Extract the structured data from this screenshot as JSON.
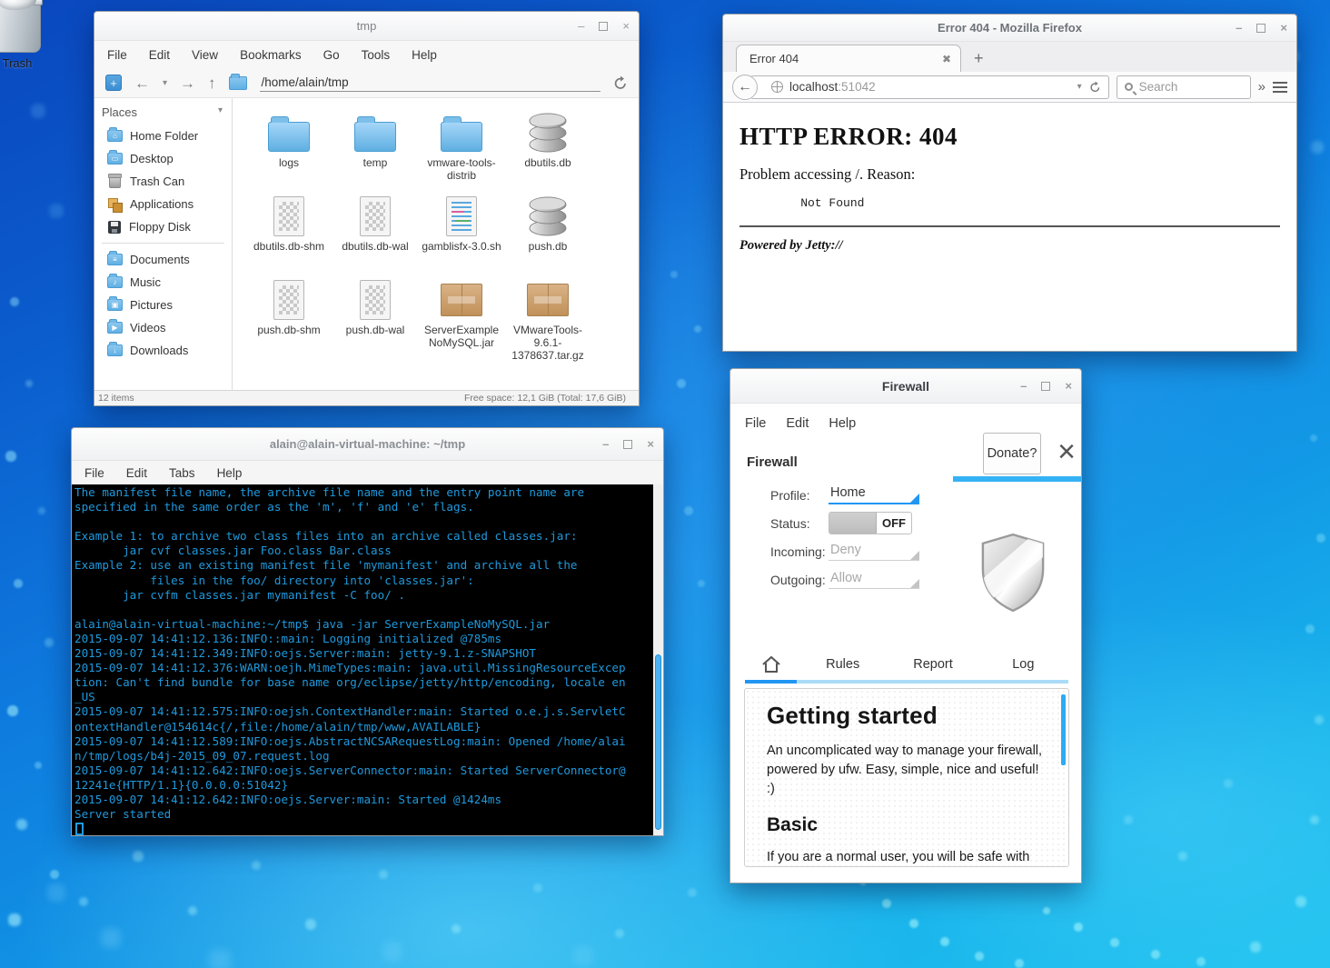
{
  "desktop": {
    "trash_label": "Trash"
  },
  "file_manager": {
    "title": "tmp",
    "menu": [
      "File",
      "Edit",
      "View",
      "Bookmarks",
      "Go",
      "Tools",
      "Help"
    ],
    "path": "/home/alain/tmp",
    "places_header": "Places",
    "places": [
      {
        "label": "Home Folder",
        "icon": "home-folder-icon"
      },
      {
        "label": "Desktop",
        "icon": "desktop-folder-icon"
      },
      {
        "label": "Trash Can",
        "icon": "trash-can-icon"
      },
      {
        "label": "Applications",
        "icon": "applications-icon"
      },
      {
        "label": "Floppy Disk",
        "icon": "floppy-disk-icon"
      },
      {
        "label": "Documents",
        "icon": "documents-folder-icon"
      },
      {
        "label": "Music",
        "icon": "music-folder-icon"
      },
      {
        "label": "Pictures",
        "icon": "pictures-folder-icon"
      },
      {
        "label": "Videos",
        "icon": "videos-folder-icon"
      },
      {
        "label": "Downloads",
        "icon": "downloads-folder-icon"
      }
    ],
    "files": [
      {
        "name": "logs",
        "type": "folder"
      },
      {
        "name": "temp",
        "type": "folder"
      },
      {
        "name": "vmware-tools-distrib",
        "type": "folder"
      },
      {
        "name": "dbutils.db",
        "type": "database"
      },
      {
        "name": "dbutils.db-shm",
        "type": "binary"
      },
      {
        "name": "dbutils.db-wal",
        "type": "binary"
      },
      {
        "name": "gamblisfx-3.0.sh",
        "type": "script"
      },
      {
        "name": "push.db",
        "type": "database"
      },
      {
        "name": "push.db-shm",
        "type": "binary"
      },
      {
        "name": "push.db-wal",
        "type": "binary"
      },
      {
        "name": "ServerExampleNoMySQL.jar",
        "type": "archive"
      },
      {
        "name": "VMwareTools-9.6.1-1378637.tar.gz",
        "type": "archive"
      }
    ],
    "status_left": "12 items",
    "status_right": "Free space: 12,1 GiB (Total: 17,6 GiB)"
  },
  "browser": {
    "window_title": "Error 404 - Mozilla Firefox",
    "tab_label": "Error 404",
    "url_host": "localhost",
    "url_port": ":51042",
    "search_placeholder": "Search",
    "content": {
      "heading": "HTTP ERROR: 404",
      "problem": "Problem accessing /. Reason:",
      "reason": "    Not Found",
      "footer": "Powered by Jetty://"
    }
  },
  "terminal": {
    "title": "alain@alain-virtual-machine: ~/tmp",
    "menu": [
      "File",
      "Edit",
      "Tabs",
      "Help"
    ],
    "text": "The manifest file name, the archive file name and the entry point name are\nspecified in the same order as the 'm', 'f' and 'e' flags.\n\nExample 1: to archive two class files into an archive called classes.jar:\n       jar cvf classes.jar Foo.class Bar.class\nExample 2: use an existing manifest file 'mymanifest' and archive all the\n           files in the foo/ directory into 'classes.jar':\n       jar cvfm classes.jar mymanifest -C foo/ .\n\nalain@alain-virtual-machine:~/tmp$ java -jar ServerExampleNoMySQL.jar\n2015-09-07 14:41:12.136:INFO::main: Logging initialized @785ms\n2015-09-07 14:41:12.349:INFO:oejs.Server:main: jetty-9.1.z-SNAPSHOT\n2015-09-07 14:41:12.376:WARN:oejh.MimeTypes:main: java.util.MissingResourceExcep\ntion: Can't find bundle for base name org/eclipse/jetty/http/encoding, locale en\n_US\n2015-09-07 14:41:12.575:INFO:oejsh.ContextHandler:main: Started o.e.j.s.ServletC\nontextHandler@154614c{/,file:/home/alain/tmp/www,AVAILABLE}\n2015-09-07 14:41:12.589:INFO:oejs.AbstractNCSARequestLog:main: Opened /home/alai\nn/tmp/logs/b4j-2015_09_07.request.log\n2015-09-07 14:41:12.642:INFO:oejs.ServerConnector:main: Started ServerConnector@\n12241e{HTTP/1.1}{0.0.0.0:51042}\n2015-09-07 14:41:12.642:INFO:oejs.Server:main: Started @1424ms\nServer started"
  },
  "firewall": {
    "title": "Firewall",
    "menu": [
      "File",
      "Edit",
      "Help"
    ],
    "donate_label": "Donate?",
    "section_title": "Firewall",
    "profile_label": "Profile:",
    "profile_value": "Home",
    "status_label": "Status:",
    "status_value": "OFF",
    "incoming_label": "Incoming:",
    "incoming_value": "Deny",
    "outgoing_label": "Outgoing:",
    "outgoing_value": "Allow",
    "tabs": [
      "Rules",
      "Report",
      "Log"
    ],
    "doc": {
      "heading1": "Getting started",
      "para1": "An uncomplicated way to manage your firewall, powered by ufw. Easy, simple, nice and useful! :)",
      "heading2": "Basic",
      "para2": "If you are a normal user, you will be safe with this setting (Status=On, Incoming=Deny, Outgoing=Allow). Remember to append allow rules for your P2P apps:"
    },
    "colors": {
      "accent": "#2196f3",
      "underline_muted": "#aadcf7",
      "donate_bar": "#35b2f4"
    }
  }
}
